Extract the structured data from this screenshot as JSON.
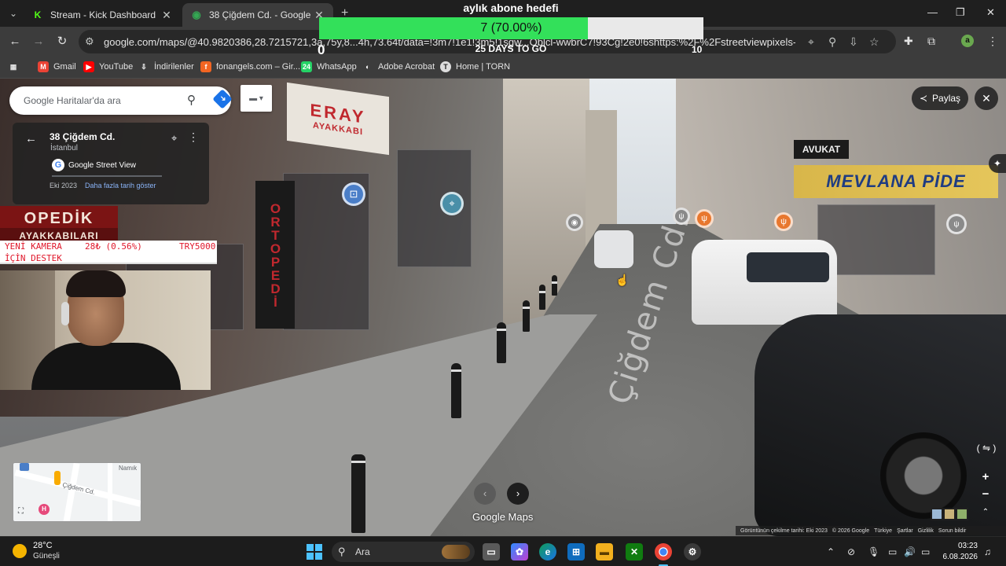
{
  "browser": {
    "tabs": [
      {
        "title": "Stream - Kick Dashboard",
        "icon": "kick-logo-icon",
        "active": false
      },
      {
        "title": "38 Çiğdem Cd. - Google Haritalar",
        "icon": "google-maps-icon",
        "active": true
      }
    ],
    "url": "google.com/maps/@40.9820386,28.7215721,3a,75y,8...4h,73.64t/data=!3m7!1e1!3m5!1sgw...Oblcl-wwbrC7!93Cg!2e0!6shttps:%2F%2Fstreetviewpixels-pa.googlea...",
    "bookmarks": [
      {
        "label": "Gmail",
        "icon": "gmail-icon"
      },
      {
        "label": "YouTube",
        "icon": "youtube-icon"
      },
      {
        "label": "İndirilenler",
        "icon": "download-icon"
      },
      {
        "label": "fonangels.com – Gir...",
        "icon": "fonangels-icon"
      },
      {
        "label": "WhatsApp",
        "icon": "whatsapp-icon"
      },
      {
        "label": "Adobe Acrobat",
        "icon": "acrobat-icon"
      },
      {
        "label": "Home | TORN",
        "icon": "torn-icon"
      }
    ],
    "profile_initial": "a",
    "colors": {
      "tab_bg": "#1f1f1f",
      "toolbar": "#3c3c3c",
      "omnibox": "#282828"
    }
  },
  "goal": {
    "title": "aylık abone hedefi",
    "progress_text": "7 (70.00%)",
    "progress_fraction": 0.7,
    "min": "0",
    "max": "10",
    "days": "25 DAYS TO GO",
    "color": "#33e05a"
  },
  "support": {
    "line1": "YENİ KAMERA",
    "amount": "28₺ (0.56%)",
    "goal": "TRY5000",
    "line2": "İÇİN DESTEK",
    "color": "#e0182b"
  },
  "maps": {
    "search_placeholder": "Google Haritalar'da ara",
    "place_name": "38 Çiğdem Cd.",
    "place_city": "İstanbul",
    "provider": "Google Street View",
    "capture_date": "Eki 2023",
    "history_link": "Daha fazla tarih göster",
    "share_label": "Paylaş",
    "logo": "Google Maps",
    "minimap_labels": {
      "street": "Çiğdem Cd.",
      "north": "Namık"
    },
    "footer": [
      "Görüntünün çekilme tarihi: Eki 2023",
      "© 2026 Google",
      "Türkiye",
      "Şartlar",
      "Gizlilik",
      "Sorun bildir"
    ]
  },
  "scene": {
    "signs": {
      "eray": "ERAY",
      "eray_sub": "AYAKKABI",
      "ortopedi": "ORTOPEDİ",
      "opedik": "OPEDİK",
      "ayakkabilari": "AYAKKABILARI",
      "mevlana": "MEVLANA PİDE",
      "avukat": "AVUKAT"
    },
    "road_label": "Çiğdem Cd."
  },
  "taskbar": {
    "temperature": "28°C",
    "condition": "Güneşli",
    "search_label": "Ara",
    "time": "03:23",
    "date": "6.08.2026"
  }
}
